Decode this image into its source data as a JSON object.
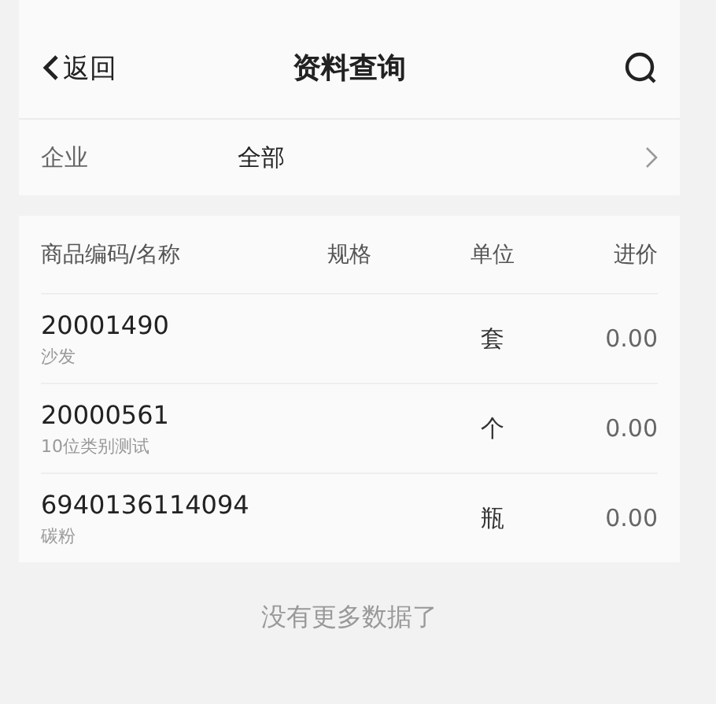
{
  "nav": {
    "back": "返回",
    "title": "资料查询"
  },
  "filter": {
    "label": "企业",
    "value": "全部"
  },
  "table": {
    "columns": [
      "商品编码/名称",
      "规格",
      "单位",
      "进价"
    ],
    "rows": [
      {
        "code": "20001490",
        "name": "沙发",
        "unit": "套",
        "price": "0.00"
      },
      {
        "code": "20000561",
        "name": "10位类别测试",
        "unit": "个",
        "price": "0.00"
      },
      {
        "code": "6940136114094",
        "name": "碳粉",
        "unit": "瓶",
        "price": "0.00"
      }
    ]
  },
  "footer": "没有更多数据了"
}
